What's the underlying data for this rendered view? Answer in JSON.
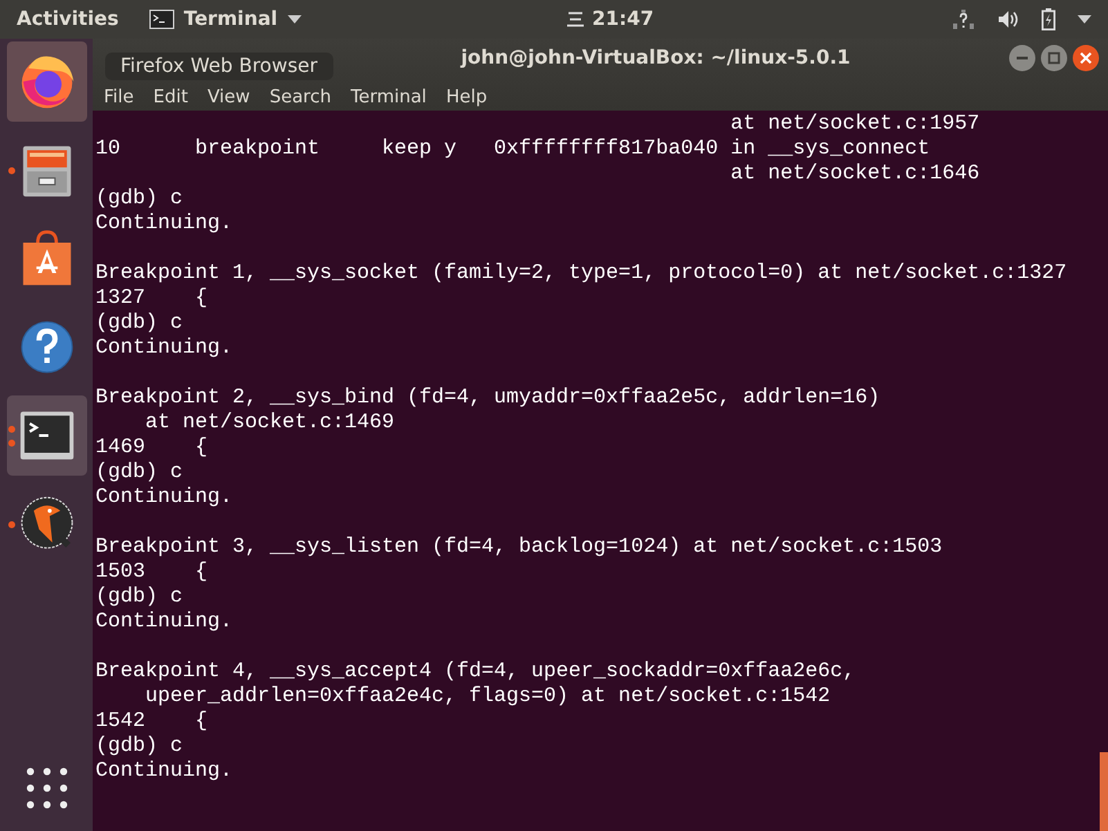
{
  "top_bar": {
    "activities": "Activities",
    "app_menu": "Terminal",
    "clock": "21:47"
  },
  "dock": {
    "items": [
      {
        "kind": "firefox",
        "running": false,
        "selected": false,
        "hovered": true
      },
      {
        "kind": "files",
        "running": true,
        "selected": false,
        "hovered": false
      },
      {
        "kind": "store",
        "running": false,
        "selected": false,
        "hovered": false
      },
      {
        "kind": "help",
        "running": false,
        "selected": false,
        "hovered": false
      },
      {
        "kind": "terminal",
        "running": true,
        "selected": true,
        "hovered": false,
        "multiple_windows": true
      },
      {
        "kind": "bird",
        "running": true,
        "selected": false,
        "hovered": false
      }
    ]
  },
  "tooltip": "Firefox Web Browser",
  "window": {
    "title": "john@john-VirtualBox: ~/linux-5.0.1",
    "menu": [
      "File",
      "Edit",
      "View",
      "Search",
      "Terminal",
      "Help"
    ],
    "terminal_blocks": [
      [
        "                                                   at net/socket.c:1957",
        "10      breakpoint     keep y   0xffffffff817ba040 in __sys_connect",
        "                                                   at net/socket.c:1646",
        "(gdb) c",
        "Continuing."
      ],
      [
        "Breakpoint 1, __sys_socket (family=2, type=1, protocol=0) at net/socket.c:1327",
        "1327    {",
        "(gdb) c",
        "Continuing."
      ],
      [
        "Breakpoint 2, __sys_bind (fd=4, umyaddr=0xffaa2e5c, addrlen=16)",
        "    at net/socket.c:1469",
        "1469    {",
        "(gdb) c",
        "Continuing."
      ],
      [
        "Breakpoint 3, __sys_listen (fd=4, backlog=1024) at net/socket.c:1503",
        "1503    {",
        "(gdb) c",
        "Continuing."
      ],
      [
        "Breakpoint 4, __sys_accept4 (fd=4, upeer_sockaddr=0xffaa2e6c,",
        "    upeer_addrlen=0xffaa2e4c, flags=0) at net/socket.c:1542",
        "1542    {",
        "(gdb) c",
        "Continuing."
      ]
    ]
  }
}
